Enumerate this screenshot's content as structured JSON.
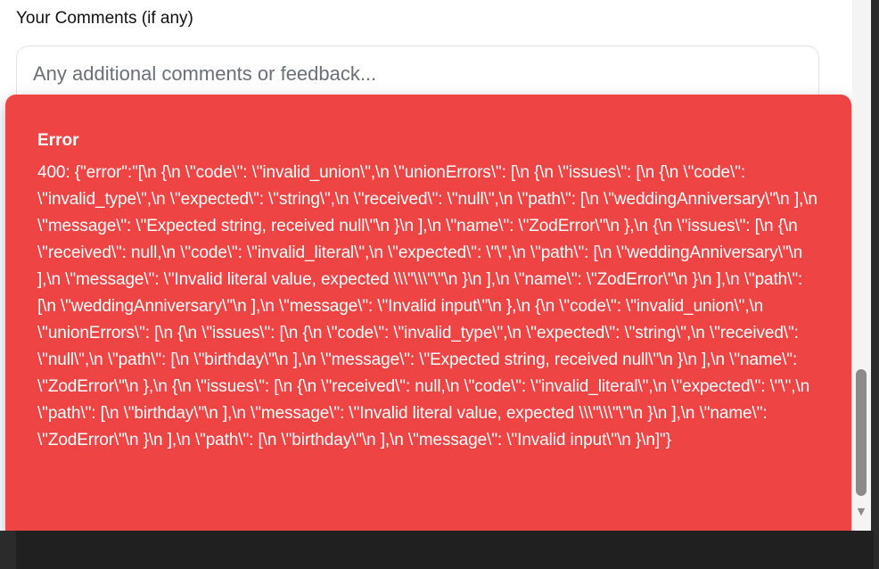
{
  "form": {
    "comments_label": "Your Comments (if any)",
    "comments_placeholder": "Any additional comments or feedback...",
    "comments_value": ""
  },
  "toast": {
    "title": "Error",
    "message": "400: {\"error\":\"[\\n {\\n \\\"code\\\": \\\"invalid_union\\\",\\n \\\"unionErrors\\\": [\\n {\\n \\\"issues\\\": [\\n {\\n \\\"code\\\": \\\"invalid_type\\\",\\n \\\"expected\\\": \\\"string\\\",\\n \\\"received\\\": \\\"null\\\",\\n \\\"path\\\": [\\n \\\"weddingAnniversary\\\"\\n ],\\n \\\"message\\\": \\\"Expected string, received null\\\"\\n }\\n ],\\n \\\"name\\\": \\\"ZodError\\\"\\n },\\n {\\n \\\"issues\\\": [\\n {\\n \\\"received\\\": null,\\n \\\"code\\\": \\\"invalid_literal\\\",\\n \\\"expected\\\": \\\"\\\",\\n \\\"path\\\": [\\n \\\"weddingAnniversary\\\"\\n ],\\n \\\"message\\\": \\\"Invalid literal value, expected \\\\\\\"\\\\\\\"\\\"\\n }\\n ],\\n \\\"name\\\": \\\"ZodError\\\"\\n }\\n ],\\n \\\"path\\\": [\\n \\\"weddingAnniversary\\\"\\n ],\\n \\\"message\\\": \\\"Invalid input\\\"\\n },\\n {\\n \\\"code\\\": \\\"invalid_union\\\",\\n \\\"unionErrors\\\": [\\n {\\n \\\"issues\\\": [\\n {\\n \\\"code\\\": \\\"invalid_type\\\",\\n \\\"expected\\\": \\\"string\\\",\\n \\\"received\\\": \\\"null\\\",\\n \\\"path\\\": [\\n \\\"birthday\\\"\\n ],\\n \\\"message\\\": \\\"Expected string, received null\\\"\\n }\\n ],\\n \\\"name\\\": \\\"ZodError\\\"\\n },\\n {\\n \\\"issues\\\": [\\n {\\n \\\"received\\\": null,\\n \\\"code\\\": \\\"invalid_literal\\\",\\n \\\"expected\\\": \\\"\\\",\\n \\\"path\\\": [\\n \\\"birthday\\\"\\n ],\\n \\\"message\\\": \\\"Invalid literal value, expected \\\\\\\"\\\\\\\"\\\"\\n }\\n ],\\n \\\"name\\\": \\\"ZodError\\\"\\n }\\n ],\\n \\\"path\\\": [\\n \\\"birthday\\\"\\n ],\\n \\\"message\\\": \\\"Invalid input\\\"\\n }\\n]\"}"
  },
  "colors": {
    "toast_background": "#ef4444",
    "toast_text": "#ffffff",
    "label_text": "#111111",
    "placeholder_text": "#6b6f76",
    "input_border": "#e2e4e8"
  },
  "icons": {
    "scroll_down": "chevron-down-icon"
  },
  "scrollbar": {
    "arrow_glyph": "▼"
  }
}
